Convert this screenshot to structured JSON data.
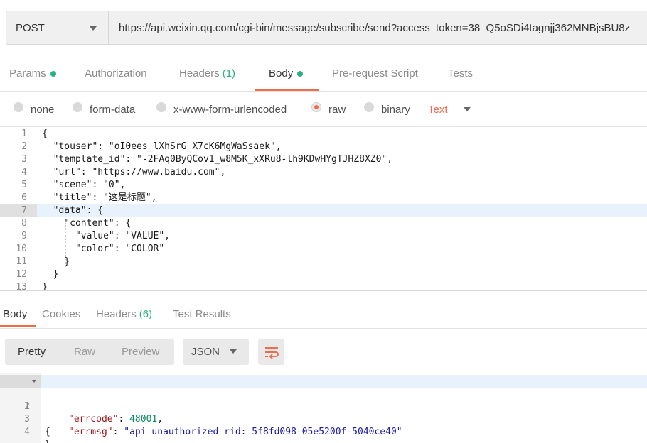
{
  "request": {
    "method": "POST",
    "url": "https://api.weixin.qq.com/cgi-bin/message/subscribe/send?access_token=38_Q5oSDi4tagnjj362MNBjsBU8z"
  },
  "request_tabs": [
    {
      "label": "Params",
      "dot": true
    },
    {
      "label": "Authorization"
    },
    {
      "label": "Headers",
      "count": "(1)"
    },
    {
      "label": "Body",
      "dot": true,
      "active": true
    },
    {
      "label": "Pre-request Script"
    },
    {
      "label": "Tests"
    }
  ],
  "body_types": {
    "options": [
      "none",
      "form-data",
      "x-www-form-urlencoded",
      "raw",
      "binary"
    ],
    "selected": "raw",
    "format": "Text"
  },
  "request_body_lines": [
    {
      "n": "1",
      "text": "{"
    },
    {
      "n": "2",
      "text": "  \"touser\": \"oI0ees_lXhSrG_X7cK6MgWaSsaek\","
    },
    {
      "n": "3",
      "text": "  \"template_id\": \"-2FAq0ByQCov1_w8M5K_xXRu8-lh9KDwHYgTJHZ8XZ0\","
    },
    {
      "n": "4",
      "text": "  \"url\": \"https://www.baidu.com\","
    },
    {
      "n": "5",
      "text": "  \"scene\": \"0\","
    },
    {
      "n": "6",
      "text": "  \"title\": \"这是标题\","
    },
    {
      "n": "7",
      "text": "  \"data\": {"
    },
    {
      "n": "8",
      "text": "    \"content\": {"
    },
    {
      "n": "9",
      "text": "      \"value\": \"VALUE\","
    },
    {
      "n": "10",
      "text": "      \"color\": \"COLOR\""
    },
    {
      "n": "11",
      "text": "    }"
    },
    {
      "n": "12",
      "text": "  }"
    },
    {
      "n": "13",
      "text": "}"
    }
  ],
  "response_tabs": [
    {
      "label": "Body",
      "active": true
    },
    {
      "label": "Cookies"
    },
    {
      "label": "Headers",
      "count": "(6)"
    },
    {
      "label": "Test Results"
    }
  ],
  "response_toolbar": {
    "views": [
      "Pretty",
      "Raw",
      "Preview"
    ],
    "active_view": "Pretty",
    "format": "JSON",
    "wrap_icon": "wrap-lines-icon"
  },
  "response_body": {
    "line_numbers": [
      "1",
      "2",
      "3",
      "4"
    ],
    "open_brace": "{",
    "errcode_key": "\"errcode\"",
    "errcode_value": "48001",
    "errmsg_key": "\"errmsg\"",
    "errmsg_value": "\"api unauthorized rid: 5f8fd098-05e5200f-5040ce40\"",
    "close_brace": "}"
  },
  "colors": {
    "accent": "#ef6c4d",
    "status_dot": "#2bb07f"
  }
}
